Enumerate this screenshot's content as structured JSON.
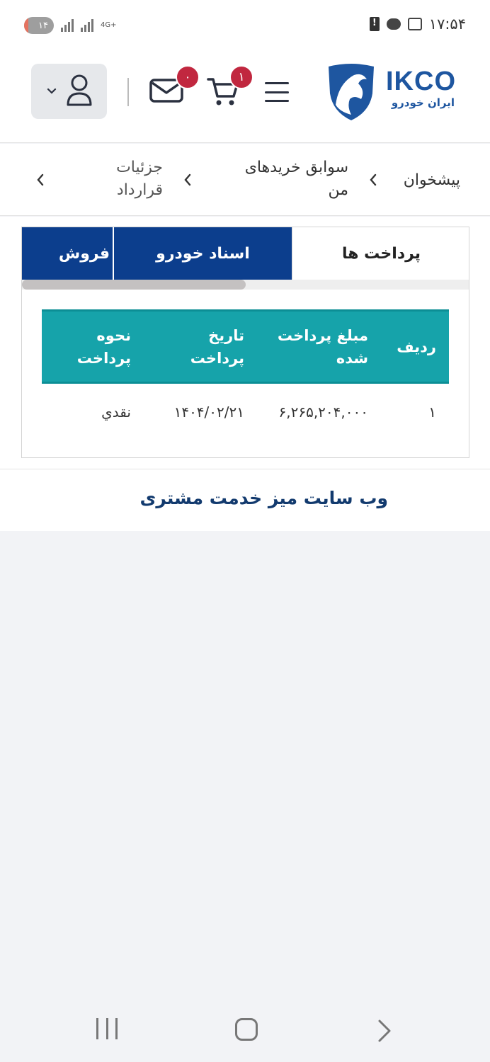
{
  "status_bar": {
    "time": "۱۷:۵۴",
    "notification_count": "۱۴",
    "network_label": "4G+"
  },
  "header": {
    "logo_text": "IKCO",
    "logo_subtitle": "ایران خودرو",
    "cart_count": "۱",
    "messages_count": "۰"
  },
  "breadcrumb": {
    "items": [
      "پیشخوان",
      "سوابق خریدهای من",
      "جزئیات قرارداد"
    ]
  },
  "tabs": [
    {
      "label": "پرداخت ها",
      "active": true
    },
    {
      "label": "اسناد خودرو",
      "active": false
    },
    {
      "label": "فروش",
      "active": false
    }
  ],
  "payments_table": {
    "headers": [
      "ردیف",
      "مبلغ پرداخت شده",
      "تاریخ پرداخت",
      "نحوه پرداخت"
    ],
    "rows": [
      [
        "۱",
        "۶,۲۶۵,۲۰۴,۰۰۰",
        "۱۴۰۴/۰۲/۲۱",
        "نقدي"
      ]
    ]
  },
  "footer": {
    "link": "وب سایت میز خدمت مشتری"
  },
  "colors": {
    "brand_blue": "#1e56a0",
    "tab_navy": "#0c3e8d",
    "table_teal": "#16a3aa",
    "badge_red": "#c1273f"
  },
  "icons": [
    "user-icon",
    "chevron-down-icon",
    "mail-icon",
    "cart-icon",
    "menu-icon",
    "chevron-left-icon",
    "battery-alert-icon",
    "chat-icon",
    "screenshot-icon",
    "signal-icon"
  ]
}
